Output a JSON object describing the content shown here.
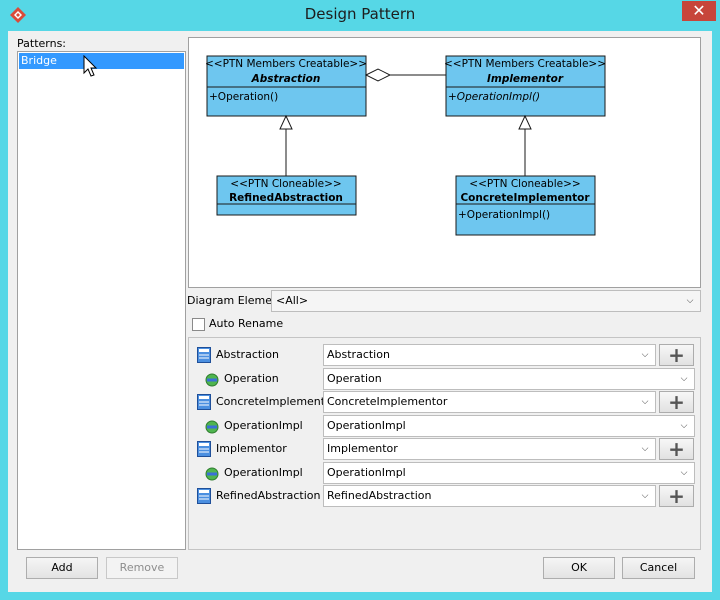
{
  "window": {
    "title": "Design Pattern",
    "close_label": "✕"
  },
  "patterns": {
    "label": "Patterns:",
    "items": [
      "Bridge"
    ]
  },
  "diagram": {
    "classes": {
      "abstraction": {
        "stereotype": "<<PTN Members Creatable>>",
        "name": "Abstraction",
        "operation": "+Operation()"
      },
      "implementor": {
        "stereotype": "<<PTN Members Creatable>>",
        "name": "Implementor",
        "operation": "+OperationImpl()"
      },
      "refined_abstraction": {
        "stereotype": "<<PTN Cloneable>>",
        "name": "RefinedAbstraction"
      },
      "concrete_implementor": {
        "stereotype": "<<PTN Cloneable>>",
        "name": "ConcreteImplementor",
        "operation": "+OperationImpl()"
      }
    },
    "colors": {
      "class_fill": "#6ec6ef",
      "class_border": "#1a1a1a"
    }
  },
  "diagram_element": {
    "label": "Diagram Element",
    "value": "<All>"
  },
  "auto_rename": {
    "label": "Auto Rename",
    "checked": false
  },
  "mappings": [
    {
      "label": "Abstraction",
      "value": "Abstraction",
      "kind": "class",
      "icon": "class-icon"
    },
    {
      "label": "Operation",
      "value": "Operation",
      "kind": "operation",
      "icon": "operation-icon"
    },
    {
      "label": "ConcreteImplementor",
      "value": "ConcreteImplementor",
      "kind": "class",
      "icon": "class-icon"
    },
    {
      "label": "OperationImpl",
      "value": "OperationImpl",
      "kind": "operation",
      "icon": "operation-icon"
    },
    {
      "label": "Implementor",
      "value": "Implementor",
      "kind": "class",
      "icon": "class-icon"
    },
    {
      "label": "OperationImpl",
      "value": "OperationImpl",
      "kind": "operation",
      "icon": "operation-icon"
    },
    {
      "label": "RefinedAbstraction",
      "value": "RefinedAbstraction",
      "kind": "class",
      "icon": "class-icon"
    }
  ],
  "buttons": {
    "add": "Add",
    "remove": "Remove",
    "ok": "OK",
    "cancel": "Cancel",
    "plus": "+"
  }
}
